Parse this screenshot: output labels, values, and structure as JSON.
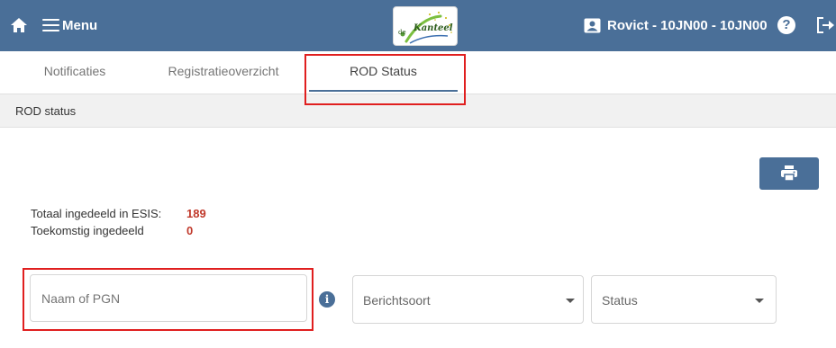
{
  "header": {
    "menu_label": "Menu",
    "logo_text": "de Kanteel",
    "user_label": "Rovict - 10JN00 - 10JN00",
    "help_glyph": "?",
    "icons": [
      "home-icon",
      "menu-icon",
      "user-card-icon",
      "help-icon",
      "logout-icon"
    ],
    "background_color": "#4a6f98"
  },
  "tabs": [
    {
      "label": "Notificaties",
      "active": false
    },
    {
      "label": "Registratieoverzicht",
      "active": false
    },
    {
      "label": "ROD Status",
      "active": true
    }
  ],
  "breadcrumb": "ROD status",
  "toolbar": {
    "print_icon": "print-icon"
  },
  "stats": [
    {
      "label": "Totaal ingedeeld in ESIS:",
      "value": "189"
    },
    {
      "label": "Toekomstig ingedeeld",
      "value": "0"
    }
  ],
  "filters": {
    "name_placeholder": "Naam of PGN",
    "name_value": "",
    "info_glyph": "i",
    "type_label": "Berichtsoort",
    "status_label": "Status"
  },
  "colors": {
    "accent": "#4a6f98",
    "stat_value": "#c0392b",
    "highlight": "#e01f1f"
  }
}
